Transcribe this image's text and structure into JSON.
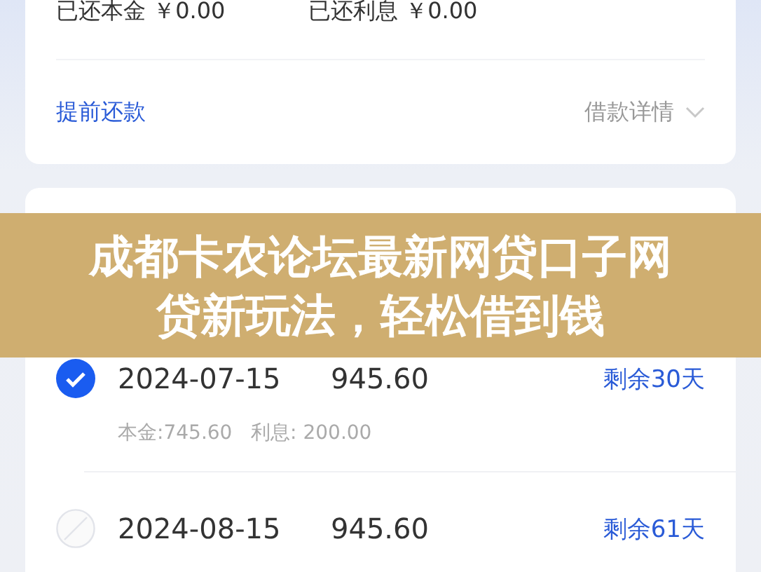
{
  "summary": {
    "repaid_principal": "已还本金 ￥0.00",
    "repaid_interest": "已还利息 ￥0.00",
    "prepay_link": "提前还款",
    "details_link": "借款详情"
  },
  "schedule": {
    "rows": [
      {
        "date": "2024-07-15",
        "amount": "945.60",
        "remaining": "剩余30天",
        "checked": true,
        "breakdown": "本金:745.60   利息: 200.00"
      },
      {
        "date": "2024-08-15",
        "amount": "945.60",
        "remaining": "剩余61天",
        "checked": false
      }
    ]
  },
  "banner": {
    "headline_lines": [
      "成都卡农论坛最新网贷口子网",
      "贷新玩法，轻松借到钱"
    ]
  }
}
